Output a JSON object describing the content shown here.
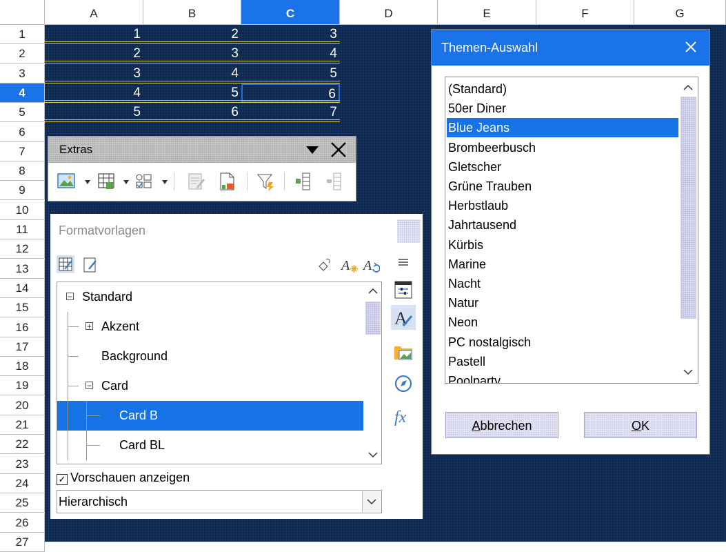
{
  "sheet": {
    "columns": [
      "A",
      "B",
      "C",
      "D",
      "E",
      "F",
      "G"
    ],
    "selected_column": "C",
    "rows": [
      "1",
      "2",
      "3",
      "4",
      "5",
      "6",
      "7",
      "8",
      "9",
      "10",
      "11",
      "12",
      "13",
      "14",
      "15",
      "16",
      "17",
      "18",
      "19",
      "20",
      "21",
      "22",
      "23",
      "24",
      "25",
      "26",
      "27"
    ],
    "selected_row": "4",
    "cells": [
      [
        "1",
        "2",
        "3"
      ],
      [
        "2",
        "3",
        "4"
      ],
      [
        "3",
        "4",
        "5"
      ],
      [
        "4",
        "5",
        "6"
      ],
      [
        "5",
        "6",
        "7"
      ]
    ]
  },
  "extras_toolbar": {
    "title": "Extras",
    "icons": [
      "insert-image-icon",
      "insert-table-icon",
      "form-controls-icon",
      "edit-data-icon",
      "document-icon",
      "filter-icon",
      "column-insert-icon",
      "column-delete-icon"
    ]
  },
  "styles_deck": {
    "title": "Formatvorlagen",
    "tree": [
      {
        "label": "Standard",
        "level": 0,
        "expander": "−"
      },
      {
        "label": "Akzent",
        "level": 1,
        "expander": "+"
      },
      {
        "label": "Background",
        "level": 1,
        "expander": ""
      },
      {
        "label": "Card",
        "level": 1,
        "expander": "−"
      },
      {
        "label": "Card B",
        "level": 2,
        "expander": "",
        "selected": true
      },
      {
        "label": "Card BL",
        "level": 2,
        "expander": ""
      }
    ],
    "preview_label": "Vorschauen anzeigen",
    "preview_checked": true,
    "filter_value": "Hierarchisch"
  },
  "theme_dialog": {
    "title": "Themen-Auswahl",
    "themes": [
      "(Standard)",
      "50er Diner",
      "Blue Jeans",
      "Brombeerbusch",
      "Gletscher",
      "Grüne Trauben",
      "Herbstlaub",
      "Jahrtausend",
      "Kürbis",
      "Marine",
      "Nacht",
      "Natur",
      "Neon",
      "PC nostalgisch",
      "Pastell",
      "Poolparty"
    ],
    "selected_theme": "Blue Jeans",
    "cancel_prefix": "A",
    "cancel_rest": "bbrechen",
    "ok_prefix": "O",
    "ok_rest": "K"
  },
  "colors": {
    "sheet_background": "#0f2a52",
    "selection": "#1673e6",
    "row_border": "#d9c24a"
  }
}
